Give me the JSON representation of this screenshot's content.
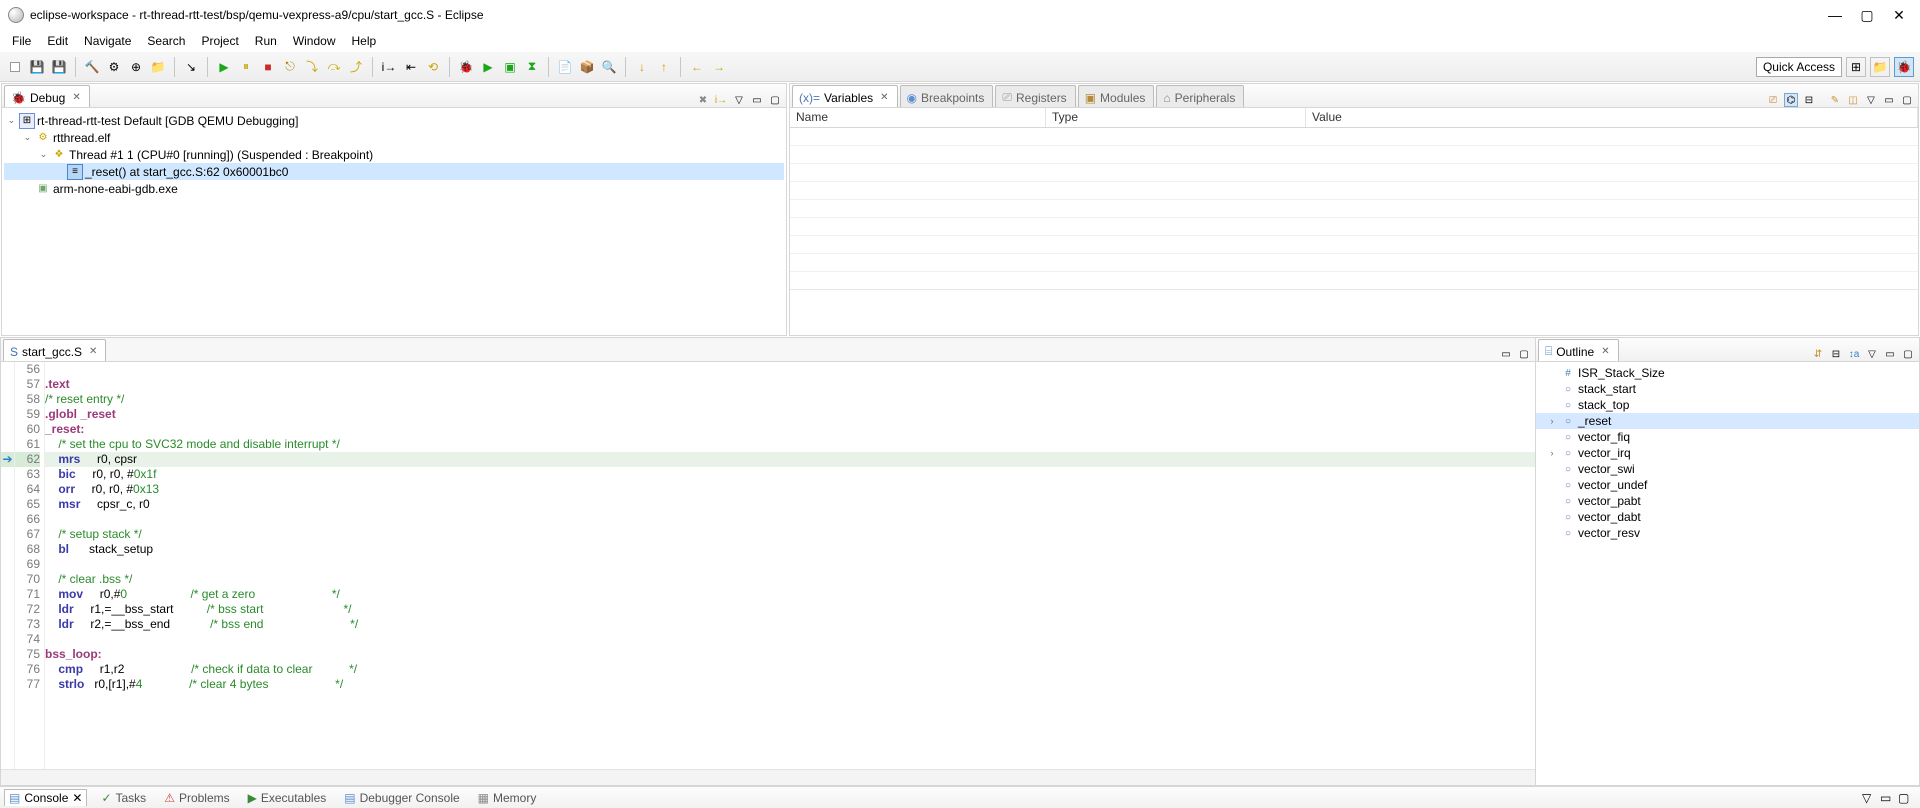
{
  "title": "eclipse-workspace - rt-thread-rtt-test/bsp/qemu-vexpress-a9/cpu/start_gcc.S - Eclipse",
  "menu": [
    "File",
    "Edit",
    "Navigate",
    "Search",
    "Project",
    "Run",
    "Window",
    "Help"
  ],
  "quick_access": "Quick Access",
  "views": {
    "debug_tab": "Debug",
    "variables_tab": "Variables",
    "breakpoints_tab": "Breakpoints",
    "registers_tab": "Registers",
    "modules_tab": "Modules",
    "peripherals_tab": "Peripherals",
    "outline_tab": "Outline"
  },
  "vars_columns": {
    "name": "Name",
    "type": "Type",
    "value": "Value"
  },
  "debug_tree": {
    "launch": "rt-thread-rtt-test Default [GDB QEMU Debugging]",
    "binary": "rtthread.elf",
    "thread": "Thread #1 1 (CPU#0 [running]) (Suspended : Breakpoint)",
    "frame": "_reset() at start_gcc.S:62 0x60001bc0",
    "gdb": "arm-none-eabi-gdb.exe"
  },
  "editor": {
    "tab_label": "start_gcc.S",
    "lines": [
      {
        "n": 56,
        "html": " "
      },
      {
        "n": 57,
        "html": "<span class='kw-dir'>.text</span>"
      },
      {
        "n": 58,
        "html": "<span class='kw-comment'>/* reset entry */</span>"
      },
      {
        "n": 59,
        "html": "<span class='kw-dir'>.globl</span> <span class='kw-label'>_reset</span>"
      },
      {
        "n": 60,
        "html": "<span class='kw-label'>_reset:</span>"
      },
      {
        "n": 61,
        "html": "    <span class='kw-comment'>/* set the cpu to SVC32 mode and disable interrupt */</span>"
      },
      {
        "n": 62,
        "hl": true,
        "html": "    <span class='kw-asm'>mrs</span>     r0, cpsr"
      },
      {
        "n": 63,
        "html": "    <span class='kw-asm'>bic</span>     r0, r0, #<span class='kw-num'>0x1f</span>"
      },
      {
        "n": 64,
        "html": "    <span class='kw-asm'>orr</span>     r0, r0, #<span class='kw-num'>0x13</span>"
      },
      {
        "n": 65,
        "html": "    <span class='kw-asm'>msr</span>     cpsr_c, r0"
      },
      {
        "n": 66,
        "html": " "
      },
      {
        "n": 67,
        "html": "    <span class='kw-comment'>/* setup stack */</span>"
      },
      {
        "n": 68,
        "html": "    <span class='kw-asm'>bl</span>      stack_setup"
      },
      {
        "n": 69,
        "html": " "
      },
      {
        "n": 70,
        "html": "    <span class='kw-comment'>/* clear .bss */</span>"
      },
      {
        "n": 71,
        "html": "    <span class='kw-asm'>mov</span>     r0,#<span class='kw-num'>0</span>                   <span class='kw-comment'>/* get a zero                       */</span>"
      },
      {
        "n": 72,
        "html": "    <span class='kw-asm'>ldr</span>     r1,=__bss_start          <span class='kw-comment'>/* bss start                        */</span>"
      },
      {
        "n": 73,
        "html": "    <span class='kw-asm'>ldr</span>     r2,=__bss_end            <span class='kw-comment'>/* bss end                          */</span>"
      },
      {
        "n": 74,
        "html": " "
      },
      {
        "n": 75,
        "html": "<span class='kw-label'>bss_loop:</span>"
      },
      {
        "n": 76,
        "html": "    <span class='kw-asm'>cmp</span>     r1,r2                    <span class='kw-comment'>/* check if data to clear           */</span>"
      },
      {
        "n": 77,
        "html": "    <span class='kw-asm'>strlo</span>   r0,[r1],#<span class='kw-num'>4</span>              <span class='kw-comment'>/* clear 4 bytes                    */</span>"
      }
    ]
  },
  "outline": [
    {
      "icon": "#",
      "expand": "",
      "label": "ISR_Stack_Size",
      "sel": false
    },
    {
      "icon": "o",
      "expand": "",
      "label": "stack_start",
      "sel": false
    },
    {
      "icon": "o",
      "expand": "",
      "label": "stack_top",
      "sel": false
    },
    {
      "icon": "o",
      "expand": ">",
      "label": "_reset",
      "sel": true
    },
    {
      "icon": "o",
      "expand": "",
      "label": "vector_fiq",
      "sel": false
    },
    {
      "icon": "o",
      "expand": ">",
      "label": "vector_irq",
      "sel": false
    },
    {
      "icon": "o",
      "expand": "",
      "label": "vector_swi",
      "sel": false
    },
    {
      "icon": "o",
      "expand": "",
      "label": "vector_undef",
      "sel": false
    },
    {
      "icon": "o",
      "expand": "",
      "label": "vector_pabt",
      "sel": false
    },
    {
      "icon": "o",
      "expand": "",
      "label": "vector_dabt",
      "sel": false
    },
    {
      "icon": "o",
      "expand": "",
      "label": "vector_resv",
      "sel": false
    }
  ],
  "bottom_tabs": {
    "console": "Console",
    "tasks": "Tasks",
    "problems": "Problems",
    "executables": "Executables",
    "debugger_console": "Debugger Console",
    "memory": "Memory"
  }
}
